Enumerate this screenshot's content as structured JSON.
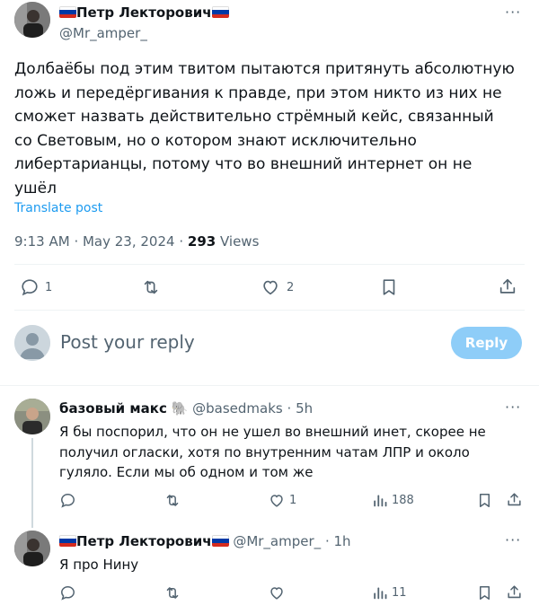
{
  "main_tweet": {
    "author_name": "Петр Лекторович",
    "author_handle": "@Mr_amper_",
    "text_lines": [
      "Долбаёбы под этим твитом пытаются притянуть абсолютную",
      "ложь и передёргивания к правде, при этом никто из них не",
      "сможет назвать действительно стрёмный кейс, связанный",
      "со Световым, но о котором знают исключительно",
      "либертарианцы, потому что во внешний интернет он не",
      "ушёл"
    ],
    "translate_label": "Translate post",
    "time": "9:13 AM",
    "date": "May 23, 2024",
    "views_count": "293",
    "views_label": "Views",
    "reply_count": "1",
    "like_count": "2"
  },
  "reply_box": {
    "placeholder": "Post your reply",
    "button_label": "Reply"
  },
  "replies": [
    {
      "author_name": "базовый макс",
      "author_handle": "@basedmaks",
      "time": "5h",
      "text_lines": [
        "Я бы поспорил, что он не ушел во внешний инет, скорее не",
        "получил огласки, хотя по внутренним чатам ЛПР и около",
        "гуляло. Если мы об одном и том же"
      ],
      "like_count": "1",
      "views_count": "188"
    },
    {
      "author_name": "Петр Лекторович",
      "author_handle": "@Mr_amper_",
      "time": "1h",
      "text_lines": [
        "Я про Нину"
      ],
      "views_count": "11"
    }
  ],
  "colors": {
    "accent": "#1d9bf0",
    "reply_button_disabled": "#8ecdf8",
    "secondary_text": "#536471",
    "divider": "#eff3f4",
    "thread_line": "#cfd9de"
  },
  "icons": {
    "more": "more-icon",
    "reply": "reply-icon",
    "retweet": "retweet-icon",
    "like": "heart-icon",
    "bookmark": "bookmark-icon",
    "share": "share-icon",
    "views": "views-icon",
    "avatar_placeholder": "person-icon"
  }
}
